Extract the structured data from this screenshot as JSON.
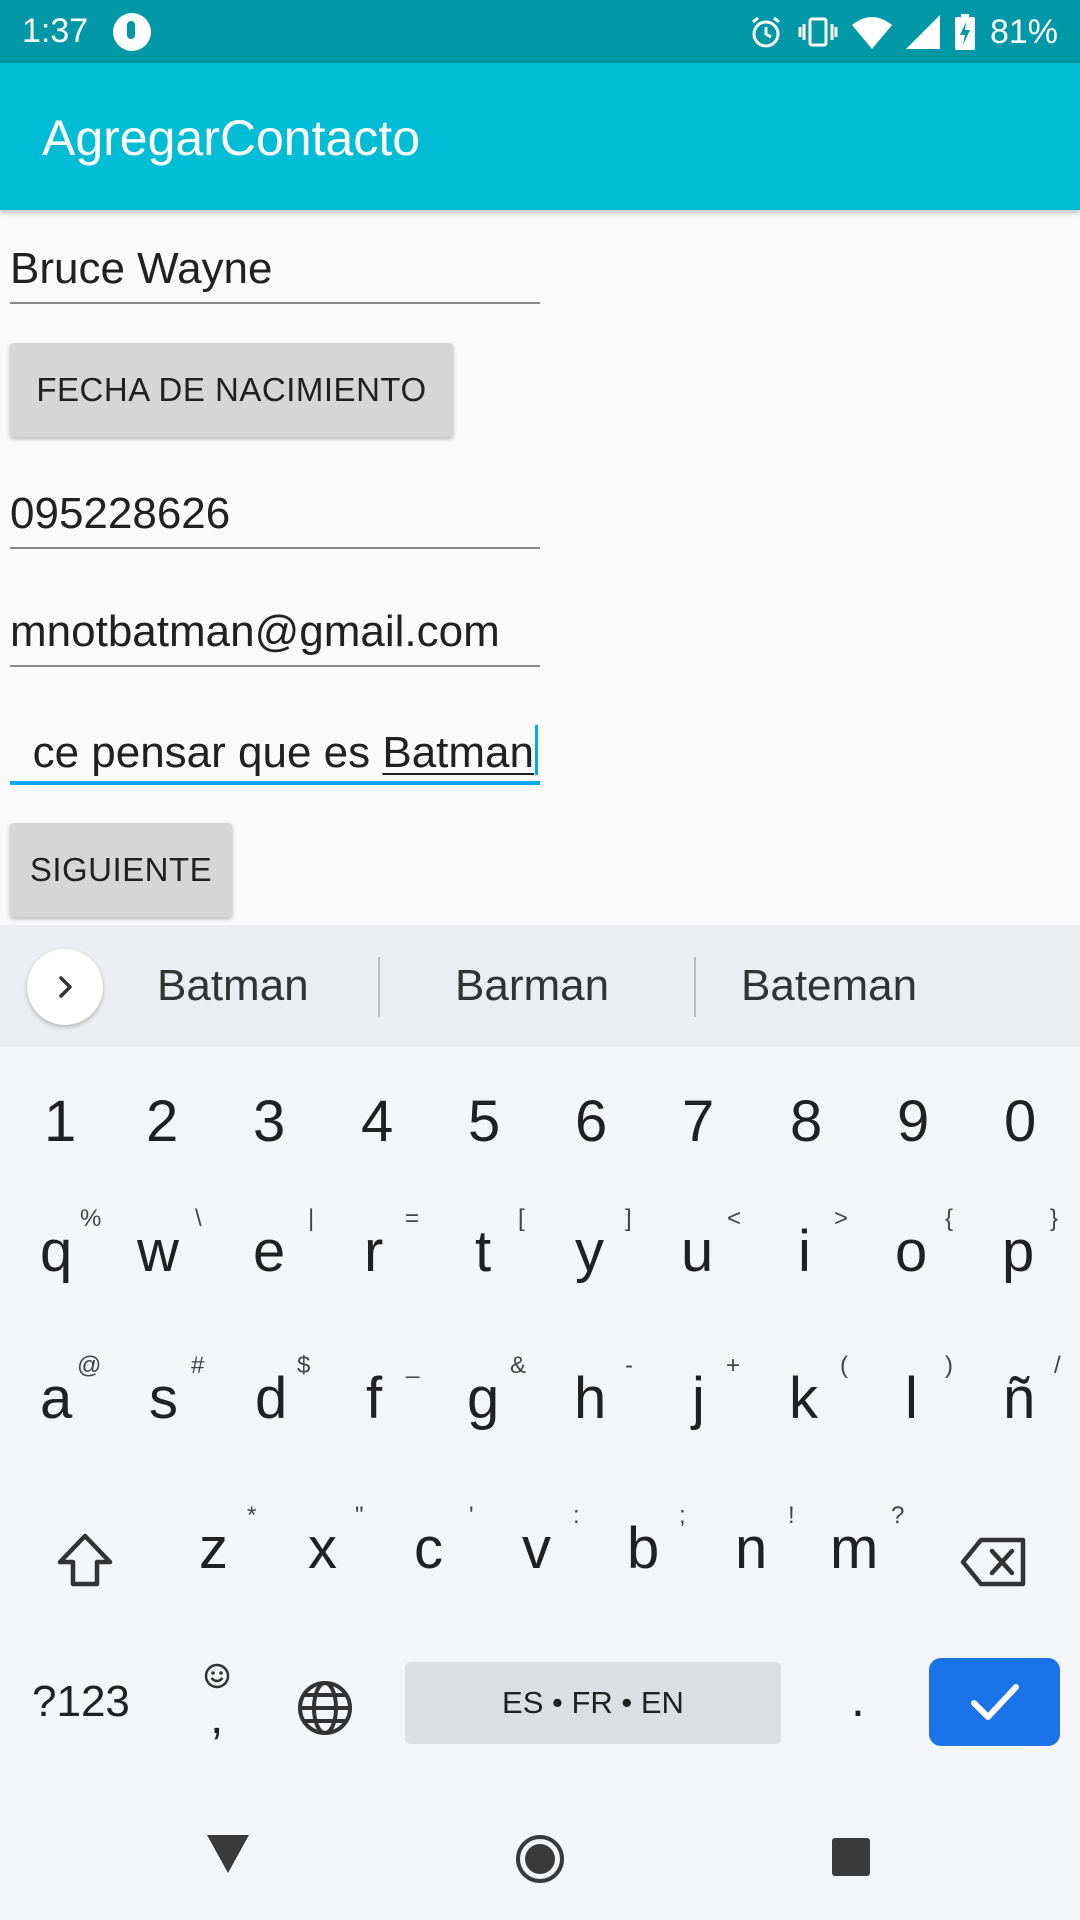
{
  "status_bar": {
    "time": "1:37",
    "battery": "81%"
  },
  "app_bar": {
    "title": "AgregarContacto"
  },
  "form": {
    "name_value": "Bruce Wayne",
    "birthdate_button": "FECHA DE NACIMIENTO",
    "phone_value": "095228626",
    "email_value": "mnotbatman@gmail.com",
    "description_prefix": "ce pensar que es ",
    "description_composing": "Batman",
    "next_button": "SIGUIENTE"
  },
  "keyboard": {
    "suggestions": [
      "Batman",
      "Barman",
      "Bateman"
    ],
    "number_row": [
      "1",
      "2",
      "3",
      "4",
      "5",
      "6",
      "7",
      "8",
      "9",
      "0"
    ],
    "row1": [
      {
        "k": "q",
        "h": "%"
      },
      {
        "k": "w",
        "h": "\\"
      },
      {
        "k": "e",
        "h": "|"
      },
      {
        "k": "r",
        "h": "="
      },
      {
        "k": "t",
        "h": "["
      },
      {
        "k": "y",
        "h": "]"
      },
      {
        "k": "u",
        "h": "<"
      },
      {
        "k": "i",
        "h": ">"
      },
      {
        "k": "o",
        "h": "{"
      },
      {
        "k": "p",
        "h": "}"
      }
    ],
    "row2": [
      {
        "k": "a",
        "h": "@"
      },
      {
        "k": "s",
        "h": "#"
      },
      {
        "k": "d",
        "h": "$"
      },
      {
        "k": "f",
        "h": "_"
      },
      {
        "k": "g",
        "h": "&"
      },
      {
        "k": "h",
        "h": "-"
      },
      {
        "k": "j",
        "h": "+"
      },
      {
        "k": "k",
        "h": "("
      },
      {
        "k": "l",
        "h": ")"
      },
      {
        "k": "ñ",
        "h": "/"
      }
    ],
    "row3": [
      {
        "k": "z",
        "h": "*"
      },
      {
        "k": "x",
        "h": "\""
      },
      {
        "k": "c",
        "h": "'"
      },
      {
        "k": "v",
        "h": ":"
      },
      {
        "k": "b",
        "h": ";"
      },
      {
        "k": "n",
        "h": "!"
      },
      {
        "k": "m",
        "h": "?"
      }
    ],
    "symbols_key": "?123",
    "comma_key": ",",
    "space_label": "ES • FR • EN",
    "period_key": ".",
    "accent_color": "#1a73e8"
  },
  "icons": {
    "status": [
      "alarm-icon",
      "vibrate-icon",
      "wifi-icon",
      "signal-icon",
      "battery-charging-icon"
    ],
    "keyboard": [
      "chevron-right-icon",
      "shift-icon",
      "backspace-icon",
      "emoji-icon",
      "globe-icon",
      "checkmark-icon"
    ],
    "nav": [
      "back-icon",
      "home-icon",
      "recents-icon"
    ]
  }
}
